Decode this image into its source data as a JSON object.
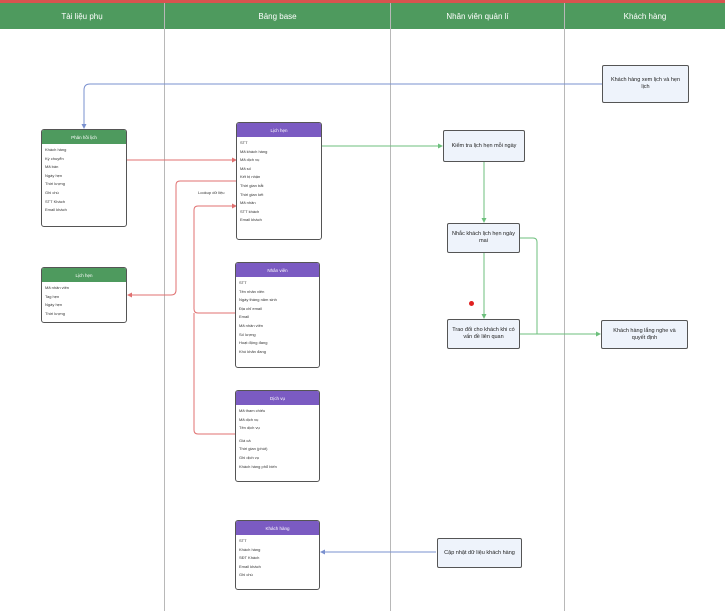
{
  "lanes": [
    {
      "title": "Tài liệu phụ"
    },
    {
      "title": "Bảng base"
    },
    {
      "title": "Nhân viên quản lí"
    },
    {
      "title": "Khách hàng"
    }
  ],
  "tables": {
    "phan_hoi": {
      "title": "Phản hồi lịch",
      "rows": [
        "Khách hàng",
        "Ký chuyển",
        "Mã bán",
        "Ngày hẹn",
        "Thời lượng",
        "Ghi chú",
        "STT Khách",
        "Email khách"
      ]
    },
    "lich_hen": {
      "title": "Lịch hẹn",
      "rows": [
        "STT",
        "Mã khách hàng",
        "Mã dịch vụ",
        "Mã số",
        "Kết bị nhận",
        "Thời gian bắt",
        "Thời gian kết",
        "Mã nhân",
        "STT khách",
        "Email khách"
      ]
    },
    "lich_hen_phu": {
      "title": "Lịch hẹn",
      "rows": [
        "Mã nhân viên",
        "Tag hẹn",
        "Ngày hẹn",
        "Thời lượng"
      ]
    },
    "nhan_vien": {
      "title": "Nhân viên",
      "rows": [
        "STT",
        "Tên nhân viên",
        "Ngày tháng năm sinh",
        "Địa chỉ email",
        "Email",
        "Mã nhân viên",
        "Số lượng",
        "Hoạt động đang",
        "Khó khăn đang"
      ]
    },
    "dich_vu": {
      "title": "Dịch vụ",
      "rows": [
        "Mã tham chiếu",
        "Mã dịch vụ",
        "Tên dịch vụ",
        "",
        "Giá cả",
        "Thời gian (phút)",
        "Ghi dịch vụ",
        "Khách hàng phổ biến"
      ]
    },
    "khach_hang": {
      "title": "Khách hàng",
      "rows": [
        "STT",
        "Khách hàng",
        "SĐT Khách",
        "Email khách",
        "Ghi chú"
      ]
    }
  },
  "processes": {
    "customer_view": "Khách hàng xem lịch và hẹn lịch",
    "check_daily": "Kiểm tra lịch hẹn mỗi ngày",
    "remind": "Nhắc khách lịch hẹn ngày mai",
    "exchange": "Trao đổi cho khách khi có vấn đề liên quan",
    "listen": "Khách hàng lắng nghe và quyết định",
    "update": "Cập nhật dữ liệu khách hàng"
  },
  "labels": {
    "lookup": "Lookup dữ liệu"
  },
  "colors": {
    "header": "#4e9a5e",
    "purple": "#7b5bc2",
    "red_edge": "#e07070",
    "green_edge": "#6cbf7c",
    "blue_edge": "#7a90cf"
  }
}
